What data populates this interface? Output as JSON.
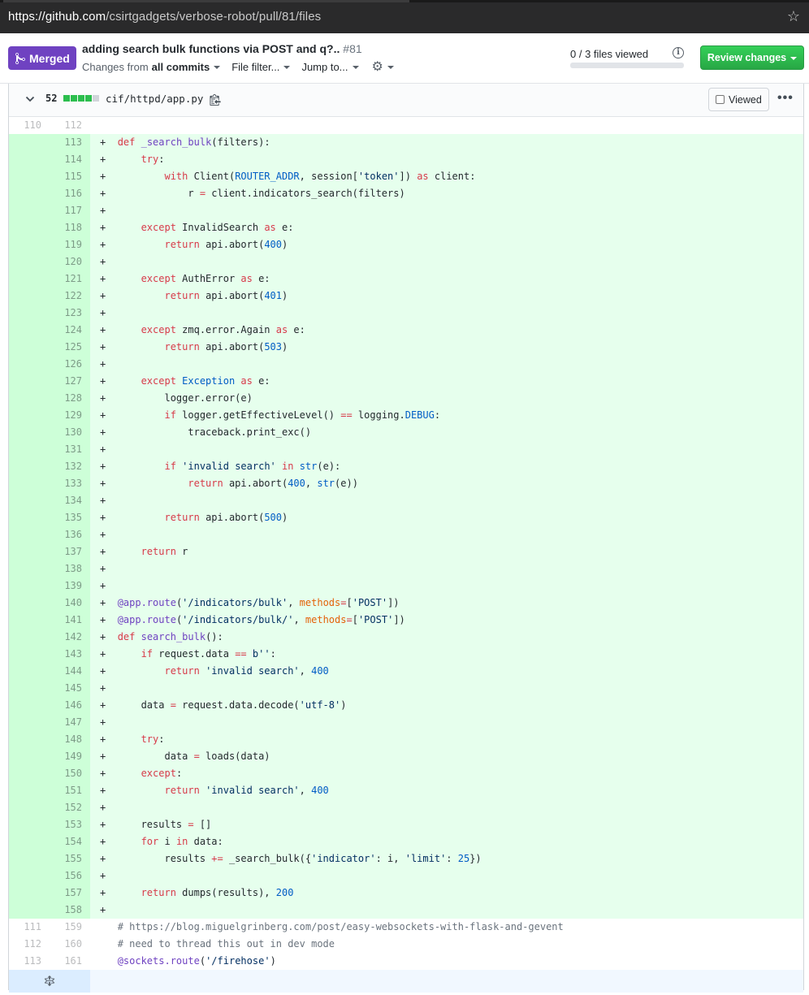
{
  "browser": {
    "url_host": "https://github.com",
    "url_path": "/csirtgadgets/verbose-robot/pull/81/files"
  },
  "pr": {
    "status": "Merged",
    "title": "adding search bulk functions via POST and q?..",
    "number": "#81",
    "changes_from_prefix": "Changes from",
    "changes_from_value": "all commits",
    "file_filter": "File filter...",
    "jump_to": "Jump to...",
    "files_viewed": "0 / 3 files viewed",
    "review_button": "Review changes",
    "info_glyph": "i"
  },
  "file": {
    "diffstat": "52",
    "path": "cif/httpd/app.py",
    "viewed_label": "Viewed",
    "more_glyph": "•••"
  },
  "diff_rows": [
    {
      "type": "ctx",
      "old": "110",
      "new": "112",
      "tokens": []
    },
    {
      "type": "add",
      "old": "",
      "new": "113",
      "tokens": [
        [
          "p",
          "+  "
        ],
        [
          "kw",
          "def "
        ],
        [
          "fn",
          "_search_bulk"
        ],
        [
          "p",
          "(filters):"
        ]
      ]
    },
    {
      "type": "add",
      "old": "",
      "new": "114",
      "tokens": [
        [
          "p",
          "+      "
        ],
        [
          "kw",
          "try"
        ],
        [
          "p",
          ":"
        ]
      ]
    },
    {
      "type": "add",
      "old": "",
      "new": "115",
      "tokens": [
        [
          "p",
          "+          "
        ],
        [
          "kw",
          "with "
        ],
        [
          "p",
          "Client("
        ],
        [
          "const",
          "ROUTER_ADDR"
        ],
        [
          "p",
          ", session["
        ],
        [
          "str",
          "'token'"
        ],
        [
          "p",
          "]) "
        ],
        [
          "kw",
          "as"
        ],
        [
          "p",
          " client:"
        ]
      ]
    },
    {
      "type": "add",
      "old": "",
      "new": "116",
      "tokens": [
        [
          "p",
          "+              r "
        ],
        [
          "kw",
          "="
        ],
        [
          "p",
          " client.indicators_search(filters)"
        ]
      ]
    },
    {
      "type": "add",
      "old": "",
      "new": "117",
      "tokens": [
        [
          "p",
          "+"
        ]
      ]
    },
    {
      "type": "add",
      "old": "",
      "new": "118",
      "tokens": [
        [
          "p",
          "+      "
        ],
        [
          "kw",
          "except "
        ],
        [
          "p",
          "InvalidSearch "
        ],
        [
          "kw",
          "as"
        ],
        [
          "p",
          " e:"
        ]
      ]
    },
    {
      "type": "add",
      "old": "",
      "new": "119",
      "tokens": [
        [
          "p",
          "+          "
        ],
        [
          "kw",
          "return "
        ],
        [
          "p",
          "api.abort("
        ],
        [
          "num",
          "400"
        ],
        [
          "p",
          ")"
        ]
      ]
    },
    {
      "type": "add",
      "old": "",
      "new": "120",
      "tokens": [
        [
          "p",
          "+"
        ]
      ]
    },
    {
      "type": "add",
      "old": "",
      "new": "121",
      "tokens": [
        [
          "p",
          "+      "
        ],
        [
          "kw",
          "except "
        ],
        [
          "p",
          "AuthError "
        ],
        [
          "kw",
          "as"
        ],
        [
          "p",
          " e:"
        ]
      ]
    },
    {
      "type": "add",
      "old": "",
      "new": "122",
      "tokens": [
        [
          "p",
          "+          "
        ],
        [
          "kw",
          "return "
        ],
        [
          "p",
          "api.abort("
        ],
        [
          "num",
          "401"
        ],
        [
          "p",
          ")"
        ]
      ]
    },
    {
      "type": "add",
      "old": "",
      "new": "123",
      "tokens": [
        [
          "p",
          "+"
        ]
      ]
    },
    {
      "type": "add",
      "old": "",
      "new": "124",
      "tokens": [
        [
          "p",
          "+      "
        ],
        [
          "kw",
          "except "
        ],
        [
          "p",
          "zmq.error.Again "
        ],
        [
          "kw",
          "as"
        ],
        [
          "p",
          " e:"
        ]
      ]
    },
    {
      "type": "add",
      "old": "",
      "new": "125",
      "tokens": [
        [
          "p",
          "+          "
        ],
        [
          "kw",
          "return "
        ],
        [
          "p",
          "api.abort("
        ],
        [
          "num",
          "503"
        ],
        [
          "p",
          ")"
        ]
      ]
    },
    {
      "type": "add",
      "old": "",
      "new": "126",
      "tokens": [
        [
          "p",
          "+"
        ]
      ]
    },
    {
      "type": "add",
      "old": "",
      "new": "127",
      "tokens": [
        [
          "p",
          "+      "
        ],
        [
          "kw",
          "except "
        ],
        [
          "const",
          "Exception "
        ],
        [
          "kw",
          "as"
        ],
        [
          "p",
          " e:"
        ]
      ]
    },
    {
      "type": "add",
      "old": "",
      "new": "128",
      "tokens": [
        [
          "p",
          "+          logger.error(e)"
        ]
      ]
    },
    {
      "type": "add",
      "old": "",
      "new": "129",
      "tokens": [
        [
          "p",
          "+          "
        ],
        [
          "kw",
          "if "
        ],
        [
          "p",
          "logger.getEffectiveLevel() "
        ],
        [
          "kw",
          "=="
        ],
        [
          "p",
          " logging."
        ],
        [
          "const",
          "DEBUG"
        ],
        [
          "p",
          ":"
        ]
      ]
    },
    {
      "type": "add",
      "old": "",
      "new": "130",
      "tokens": [
        [
          "p",
          "+              traceback.print_exc()"
        ]
      ]
    },
    {
      "type": "add",
      "old": "",
      "new": "131",
      "tokens": [
        [
          "p",
          "+"
        ]
      ]
    },
    {
      "type": "add",
      "old": "",
      "new": "132",
      "tokens": [
        [
          "p",
          "+          "
        ],
        [
          "kw",
          "if "
        ],
        [
          "str",
          "'invalid search' "
        ],
        [
          "kw",
          "in "
        ],
        [
          "const",
          "str"
        ],
        [
          "p",
          "(e):"
        ]
      ]
    },
    {
      "type": "add",
      "old": "",
      "new": "133",
      "tokens": [
        [
          "p",
          "+              "
        ],
        [
          "kw",
          "return "
        ],
        [
          "p",
          "api.abort("
        ],
        [
          "num",
          "400"
        ],
        [
          "p",
          ", "
        ],
        [
          "const",
          "str"
        ],
        [
          "p",
          "(e))"
        ]
      ]
    },
    {
      "type": "add",
      "old": "",
      "new": "134",
      "tokens": [
        [
          "p",
          "+"
        ]
      ]
    },
    {
      "type": "add",
      "old": "",
      "new": "135",
      "tokens": [
        [
          "p",
          "+          "
        ],
        [
          "kw",
          "return "
        ],
        [
          "p",
          "api.abort("
        ],
        [
          "num",
          "500"
        ],
        [
          "p",
          ")"
        ]
      ]
    },
    {
      "type": "add",
      "old": "",
      "new": "136",
      "tokens": [
        [
          "p",
          "+"
        ]
      ]
    },
    {
      "type": "add",
      "old": "",
      "new": "137",
      "tokens": [
        [
          "p",
          "+      "
        ],
        [
          "kw",
          "return "
        ],
        [
          "p",
          "r"
        ]
      ]
    },
    {
      "type": "add",
      "old": "",
      "new": "138",
      "tokens": [
        [
          "p",
          "+"
        ]
      ]
    },
    {
      "type": "add",
      "old": "",
      "new": "139",
      "tokens": [
        [
          "p",
          "+"
        ]
      ]
    },
    {
      "type": "add",
      "old": "",
      "new": "140",
      "tokens": [
        [
          "p",
          "+  "
        ],
        [
          "dec",
          "@app.route"
        ],
        [
          "p",
          "("
        ],
        [
          "str",
          "'/indicators/bulk'"
        ],
        [
          "p",
          ", "
        ],
        [
          "param",
          "methods"
        ],
        [
          "kw",
          "="
        ],
        [
          "p",
          "["
        ],
        [
          "str",
          "'POST'"
        ],
        [
          "p",
          "])"
        ]
      ]
    },
    {
      "type": "add",
      "old": "",
      "new": "141",
      "tokens": [
        [
          "p",
          "+  "
        ],
        [
          "dec",
          "@app.route"
        ],
        [
          "p",
          "("
        ],
        [
          "str",
          "'/indicators/bulk/'"
        ],
        [
          "p",
          ", "
        ],
        [
          "param",
          "methods"
        ],
        [
          "kw",
          "="
        ],
        [
          "p",
          "["
        ],
        [
          "str",
          "'POST'"
        ],
        [
          "p",
          "])"
        ]
      ]
    },
    {
      "type": "add",
      "old": "",
      "new": "142",
      "tokens": [
        [
          "p",
          "+  "
        ],
        [
          "kw",
          "def "
        ],
        [
          "fn",
          "search_bulk"
        ],
        [
          "p",
          "():"
        ]
      ]
    },
    {
      "type": "add",
      "old": "",
      "new": "143",
      "tokens": [
        [
          "p",
          "+      "
        ],
        [
          "kw",
          "if "
        ],
        [
          "p",
          "request.data "
        ],
        [
          "kw",
          "=="
        ],
        [
          "p",
          " "
        ],
        [
          "str",
          "b''"
        ],
        [
          "p",
          ":"
        ]
      ]
    },
    {
      "type": "add",
      "old": "",
      "new": "144",
      "tokens": [
        [
          "p",
          "+          "
        ],
        [
          "kw",
          "return "
        ],
        [
          "str",
          "'invalid search'"
        ],
        [
          "p",
          ", "
        ],
        [
          "num",
          "400"
        ]
      ]
    },
    {
      "type": "add",
      "old": "",
      "new": "145",
      "tokens": [
        [
          "p",
          "+"
        ]
      ]
    },
    {
      "type": "add",
      "old": "",
      "new": "146",
      "tokens": [
        [
          "p",
          "+      data "
        ],
        [
          "kw",
          "="
        ],
        [
          "p",
          " request.data.decode("
        ],
        [
          "str",
          "'utf-8'"
        ],
        [
          "p",
          ")"
        ]
      ]
    },
    {
      "type": "add",
      "old": "",
      "new": "147",
      "tokens": [
        [
          "p",
          "+"
        ]
      ]
    },
    {
      "type": "add",
      "old": "",
      "new": "148",
      "tokens": [
        [
          "p",
          "+      "
        ],
        [
          "kw",
          "try"
        ],
        [
          "p",
          ":"
        ]
      ]
    },
    {
      "type": "add",
      "old": "",
      "new": "149",
      "tokens": [
        [
          "p",
          "+          data "
        ],
        [
          "kw",
          "="
        ],
        [
          "p",
          " loads(data)"
        ]
      ]
    },
    {
      "type": "add",
      "old": "",
      "new": "150",
      "tokens": [
        [
          "p",
          "+      "
        ],
        [
          "kw",
          "except"
        ],
        [
          "p",
          ":"
        ]
      ]
    },
    {
      "type": "add",
      "old": "",
      "new": "151",
      "tokens": [
        [
          "p",
          "+          "
        ],
        [
          "kw",
          "return "
        ],
        [
          "str",
          "'invalid search'"
        ],
        [
          "p",
          ", "
        ],
        [
          "num",
          "400"
        ]
      ]
    },
    {
      "type": "add",
      "old": "",
      "new": "152",
      "tokens": [
        [
          "p",
          "+"
        ]
      ]
    },
    {
      "type": "add",
      "old": "",
      "new": "153",
      "tokens": [
        [
          "p",
          "+      results "
        ],
        [
          "kw",
          "="
        ],
        [
          "p",
          " []"
        ]
      ]
    },
    {
      "type": "add",
      "old": "",
      "new": "154",
      "tokens": [
        [
          "p",
          "+      "
        ],
        [
          "kw",
          "for "
        ],
        [
          "p",
          "i "
        ],
        [
          "kw",
          "in "
        ],
        [
          "p",
          "data:"
        ]
      ]
    },
    {
      "type": "add",
      "old": "",
      "new": "155",
      "tokens": [
        [
          "p",
          "+          results "
        ],
        [
          "kw",
          "+="
        ],
        [
          "p",
          " _search_bulk({"
        ],
        [
          "str",
          "'indicator'"
        ],
        [
          "p",
          ": i, "
        ],
        [
          "str",
          "'limit'"
        ],
        [
          "p",
          ": "
        ],
        [
          "num",
          "25"
        ],
        [
          "p",
          "})"
        ]
      ]
    },
    {
      "type": "add",
      "old": "",
      "new": "156",
      "tokens": [
        [
          "p",
          "+"
        ]
      ]
    },
    {
      "type": "add",
      "old": "",
      "new": "157",
      "tokens": [
        [
          "p",
          "+      "
        ],
        [
          "kw",
          "return "
        ],
        [
          "p",
          "dumps(results), "
        ],
        [
          "num",
          "200"
        ]
      ]
    },
    {
      "type": "add",
      "old": "",
      "new": "158",
      "tokens": [
        [
          "p",
          "+"
        ]
      ]
    },
    {
      "type": "ctx",
      "old": "111",
      "new": "159",
      "tokens": [
        [
          "p",
          "   "
        ],
        [
          "cm",
          "# https://blog.miguelgrinberg.com/post/easy-websockets-with-flask-and-gevent"
        ]
      ]
    },
    {
      "type": "ctx",
      "old": "112",
      "new": "160",
      "tokens": [
        [
          "p",
          "   "
        ],
        [
          "cm",
          "# need to thread this out in dev mode"
        ]
      ]
    },
    {
      "type": "ctx",
      "old": "113",
      "new": "161",
      "tokens": [
        [
          "p",
          "   "
        ],
        [
          "dec",
          "@sockets.route"
        ],
        [
          "p",
          "("
        ],
        [
          "str",
          "'/firehose'"
        ],
        [
          "p",
          ")"
        ]
      ]
    }
  ]
}
